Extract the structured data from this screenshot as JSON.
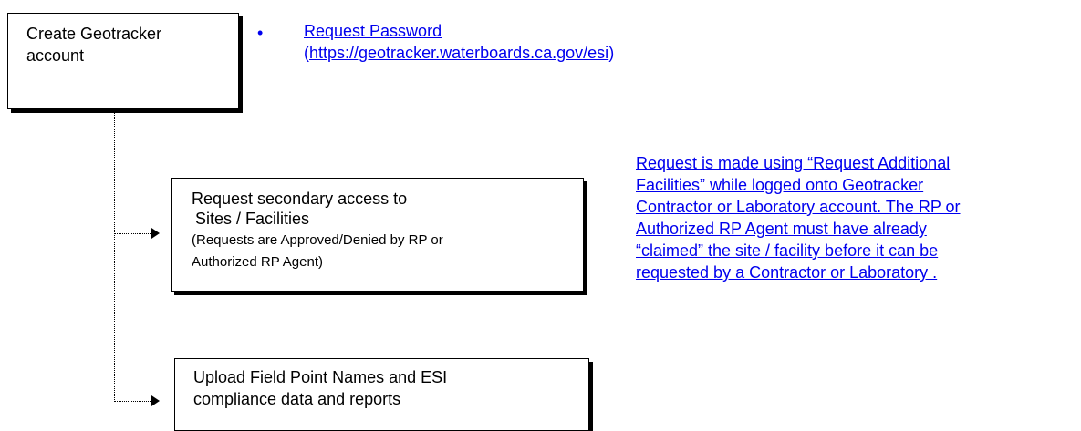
{
  "boxes": {
    "create_account": "Create Geotracker account",
    "secondary_access": {
      "line1": "Request secondary access to",
      "line2": "Sites / Facilities",
      "line3": "(Requests are Approved/Denied by RP or",
      "line4": "Authorized RP Agent)"
    },
    "upload": {
      "line1": "Upload Field Point Names and ESI",
      "line2": "compliance data and reports"
    }
  },
  "password": {
    "bullet": "•",
    "label": "Request Password",
    "open_paren": "(",
    "url": "https://geotracker.waterboards.ca.gov/esi",
    "close_paren": ")"
  },
  "note": {
    "line1": "Request is made using “Request Additional",
    "line2": "Facilities” while logged onto Geotracker",
    "line3": "Contractor or Laboratory account.  The RP or",
    "line4": "Authorized RP Agent must have already",
    "line5": "“claimed” the site / facility before it can be",
    "line6": "requested by a Contractor or Laboratory ."
  },
  "colors": {
    "link": "#0000ee",
    "line": "#000000"
  }
}
